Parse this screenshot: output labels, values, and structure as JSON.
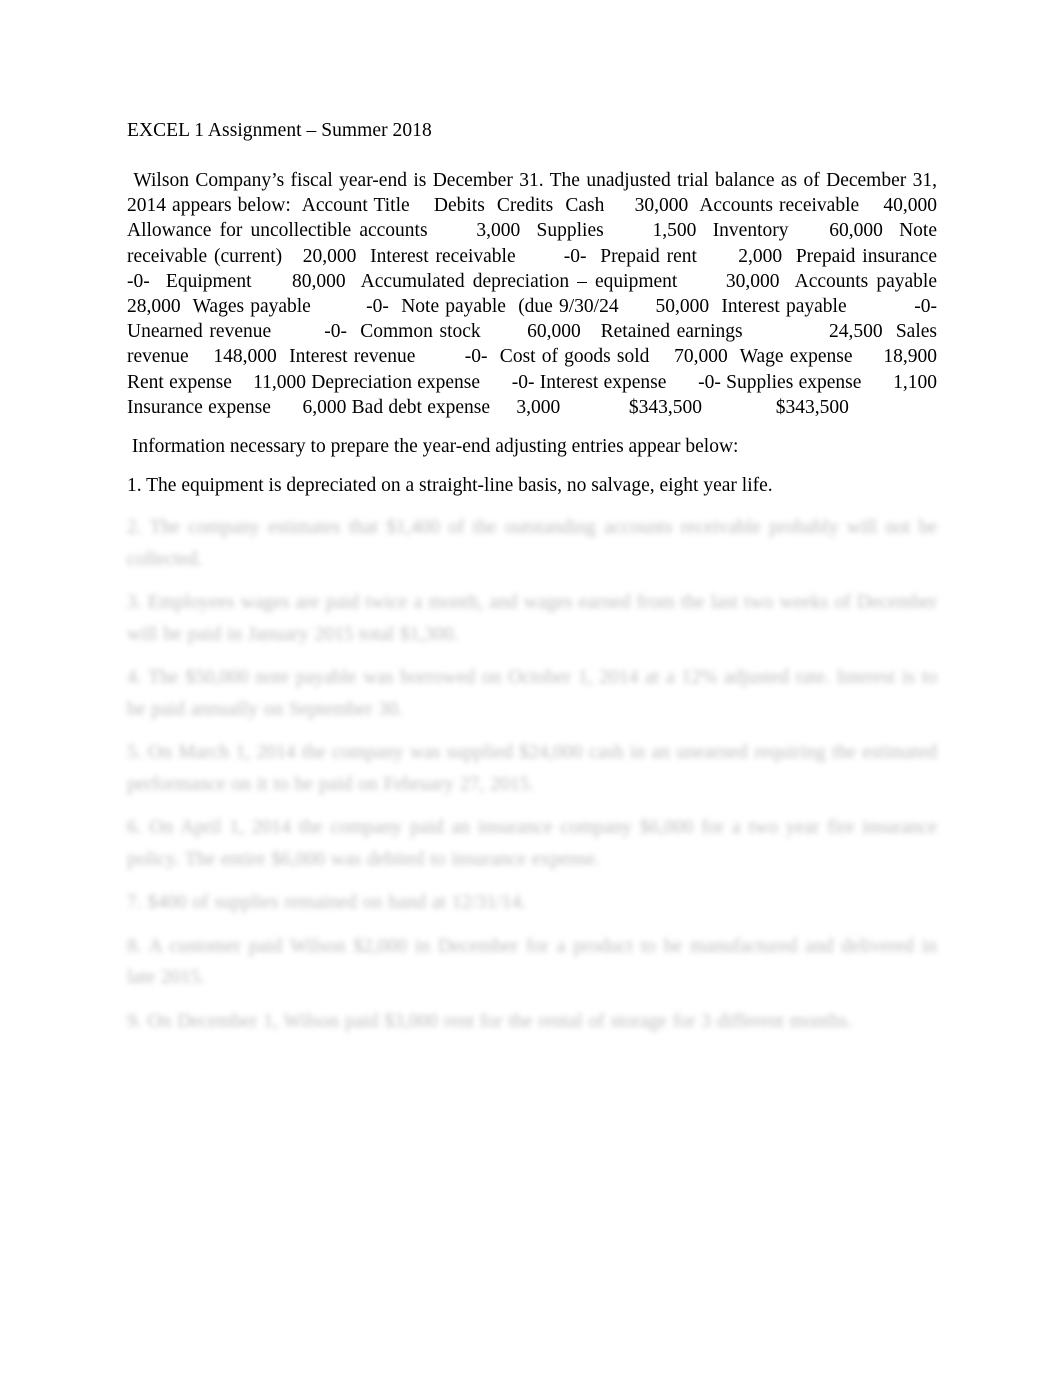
{
  "document": {
    "title_line": "EXCEL 1 Assignment – Summer 2018",
    "trial_balance_paragraph": " Wilson Company’s fiscal year-end is December 31. The unadjusted trial balance as of December 31, 2014 appears below:  Account Title    Debits  Credits  Cash     30,000  Accounts receivable    40,000  Allowance for uncollectible accounts      3,000  Supplies      1,500  Inventory     60,000  Note receivable (current)   20,000  Interest receivable       -0-  Prepaid rent      2,000  Prepaid insurance        -0-  Equipment     80,000  Accumulated depreciation – equipment      30,000  Accounts payable      28,000  Wages payable         -0-  Note payable  (due 9/30/24      50,000  Interest payable           -0-  Unearned revenue        -0-  Common stock       60,000   Retained earnings             24,500  Sales revenue    148,000  Interest revenue        -0-  Cost of goods sold    70,000  Wage expense     18,900  Rent expense    11,000 Depreciation expense      -0- Interest expense      -0- Supplies expense      1,100 Insurance expense      6,000 Bad debt expense     3,000             $343,500              $343,500",
    "information_intro": " Information necessary to prepare the year-end adjusting entries appear below:",
    "items": [
      {
        "number": "1.",
        "text": "1. The equipment is depreciated on a straight-line basis, no salvage, eight year life.",
        "legible": true
      },
      {
        "number": "2.",
        "text": "2. The company estimates that $1,400 of the outstanding accounts receivable probably will not be collected.",
        "legible": false
      },
      {
        "number": "3.",
        "text": "3. Employees wages are paid twice a month, and wages earned from the last two weeks of December will be paid in January 2015 total $1,300.",
        "legible": false
      },
      {
        "number": "4.",
        "text": "4. The $50,000 note payable was borrowed on October 1, 2014 at a 12% adjusted rate. Interest is to be paid annually on September 30.",
        "legible": false
      },
      {
        "number": "5.",
        "text": "5. On March 1, 2014 the company was supplied $24,000 cash in an unearned requiring the estimated performance on it to be paid on February 27, 2015.",
        "legible": false
      },
      {
        "number": "6.",
        "text": "6. On April 1, 2014 the company paid an insurance company $6,000 for a two year fire insurance policy. The entire $6,000 was debited to insurance expense.",
        "legible": false
      },
      {
        "number": "7.",
        "text": "7. $400 of supplies remained on hand at 12/31/14.",
        "legible": false
      },
      {
        "number": "8.",
        "text": "8. A customer paid Wilson $2,000 in December for a product to be manufactured and delivered in late 2015.",
        "legible": false
      },
      {
        "number": "9.",
        "text": "9. On December 1, Wilson paid $3,000 rent for the rental of storage for 3 different months.",
        "legible": false
      }
    ]
  }
}
